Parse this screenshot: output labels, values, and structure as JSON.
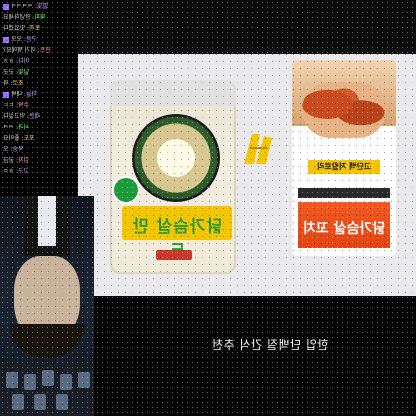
{
  "stream": {
    "caption": "한입 단백질 간식 추천"
  },
  "chat": {
    "lines": [
      {
        "nick": "별빛",
        "msg": "ㅋㅋㅋㅋ"
      },
      {
        "nick": "해피",
        "msg": "안녕하세요"
      },
      {
        "nick": "토끼",
        "msg": "맛있겠다"
      },
      {
        "nick": "구름",
        "msg": "오오"
      },
      {
        "nick": "민트",
        "msg": "이거 뭐에요?"
      },
      {
        "nick": "바다",
        "msg": "ㅎㅎ"
      },
      {
        "nick": "달빛",
        "msg": "굿굿"
      },
      {
        "nick": "초코",
        "msg": "와"
      },
      {
        "nick": "하늘",
        "msg": "대박"
      },
      {
        "nick": "수박",
        "msg": "ㄷㄷ"
      },
      {
        "nick": "레몬",
        "msg": "먹고싶다"
      },
      {
        "nick": "사과",
        "msg": "ㅋㅋ"
      },
      {
        "nick": "포도",
        "msg": "좋아요"
      },
      {
        "nick": "복숭",
        "msg": "오"
      },
      {
        "nick": "감자",
        "msg": "궁금"
      },
      {
        "nick": "고구",
        "msg": "ㅎㅇ"
      }
    ]
  },
  "products": {
    "left": {
      "name": "닭가슴살 만두"
    },
    "right": {
      "name": "닭가슴살 꼬치",
      "badge": "고단백 저칼로리"
    }
  },
  "colors": {
    "accent_green": "#2e9b2e",
    "accent_orange": "#e34412",
    "accent_yellow": "#f3c400"
  },
  "icons": {
    "middle": "yellow-sticker-icon"
  }
}
